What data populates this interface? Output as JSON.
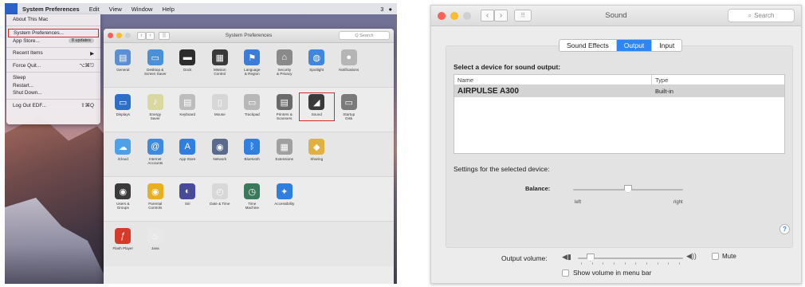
{
  "menubar": {
    "apple_glyph": "",
    "items": [
      "System Preferences",
      "Edit",
      "View",
      "Window",
      "Help"
    ],
    "status_text": "3"
  },
  "apple_menu": {
    "about": "About This Mac",
    "sysprefs": "System Preferences...",
    "appstore": "App Store...",
    "appstore_badge": "8 updates",
    "recent": "Recent Items",
    "recent_arrow": "▶",
    "force_quit": "Force Quit...",
    "force_quit_key": "⌥⌘⎋",
    "sleep": "Sleep",
    "restart": "Restart...",
    "shutdown": "Shut Down...",
    "logout": "Log Out EDF...",
    "logout_key": "⇧⌘Q"
  },
  "sysprefs": {
    "title": "System Preferences",
    "search": "Q Search",
    "rows": [
      [
        {
          "label": "General",
          "icon": "general-icon",
          "color": "#5a8fd6",
          "glyph": "▤"
        },
        {
          "label": "Desktop &\nScreen Saver",
          "icon": "desktop-icon",
          "color": "#4a90d9",
          "glyph": "▭"
        },
        {
          "label": "Dock",
          "icon": "dock-icon",
          "color": "#2c2c2c",
          "glyph": "▬"
        },
        {
          "label": "Mission\nControl",
          "icon": "mission-control-icon",
          "color": "#3a3a3a",
          "glyph": "▦"
        },
        {
          "label": "Language\n& Region",
          "icon": "language-icon",
          "color": "#3d7bd8",
          "glyph": "⚑"
        },
        {
          "label": "Security\n& Privacy",
          "icon": "security-icon",
          "color": "#8a8a8a",
          "glyph": "⌂"
        },
        {
          "label": "Spotlight",
          "icon": "spotlight-icon",
          "color": "#3f86e0",
          "glyph": "◍"
        },
        {
          "label": "Notifications",
          "icon": "notifications-icon",
          "color": "#b5b5b5",
          "glyph": "●"
        }
      ],
      [
        {
          "label": "Displays",
          "icon": "displays-icon",
          "color": "#2c6fc9",
          "glyph": "▭"
        },
        {
          "label": "Energy\nSaver",
          "icon": "energy-saver-icon",
          "color": "#d8d8a0",
          "glyph": "♪"
        },
        {
          "label": "Keyboard",
          "icon": "keyboard-icon",
          "color": "#bdbdbd",
          "glyph": "▤"
        },
        {
          "label": "Mouse",
          "icon": "mouse-icon",
          "color": "#d6d6d6",
          "glyph": "▯"
        },
        {
          "label": "Trackpad",
          "icon": "trackpad-icon",
          "color": "#b8b8b8",
          "glyph": "▭"
        },
        {
          "label": "Printers &\nScanners",
          "icon": "printer-icon",
          "color": "#6a6a6a",
          "glyph": "▤"
        },
        {
          "label": "Sound",
          "icon": "sound-icon",
          "color": "#3a3a3a",
          "glyph": "◢"
        },
        {
          "label": "Startup\nDisk",
          "icon": "startup-disk-icon",
          "color": "#7a7a7a",
          "glyph": "▭"
        }
      ],
      [
        {
          "label": "iCloud",
          "icon": "icloud-icon",
          "color": "#4ea0e8",
          "glyph": "☁"
        },
        {
          "label": "Internet\nAccounts",
          "icon": "internet-accounts-icon",
          "color": "#3d8be0",
          "glyph": "@"
        },
        {
          "label": "App Store",
          "icon": "app-store-icon",
          "color": "#2f7fe0",
          "glyph": "A"
        },
        {
          "label": "Network",
          "icon": "network-icon",
          "color": "#5a6a8a",
          "glyph": "◉"
        },
        {
          "label": "Bluetooth",
          "icon": "bluetooth-icon",
          "color": "#2f7fe0",
          "glyph": "ᛒ"
        },
        {
          "label": "Extensions",
          "icon": "extensions-icon",
          "color": "#a0a0a0",
          "glyph": "▦"
        },
        {
          "label": "Sharing",
          "icon": "sharing-icon",
          "color": "#e0b040",
          "glyph": "◆"
        }
      ],
      [
        {
          "label": "Users &\nGroups",
          "icon": "users-icon",
          "color": "#3a3a3a",
          "glyph": "◉"
        },
        {
          "label": "Parental\nControls",
          "icon": "parental-controls-icon",
          "color": "#e8b020",
          "glyph": "◉"
        },
        {
          "label": "Siri",
          "icon": "siri-icon",
          "color": "#4a4a9a",
          "glyph": "◐"
        },
        {
          "label": "Date & Time",
          "icon": "date-time-icon",
          "color": "#d8d8d8",
          "glyph": "◴"
        },
        {
          "label": "Time\nMachine",
          "icon": "time-machine-icon",
          "color": "#3a7a5a",
          "glyph": "◷"
        },
        {
          "label": "Accessibility",
          "icon": "accessibility-icon",
          "color": "#2f7fe0",
          "glyph": "✦"
        }
      ],
      [
        {
          "label": "Flash Player",
          "icon": "flash-player-icon",
          "color": "#d83a2a",
          "glyph": "ƒ"
        },
        {
          "label": "Java",
          "icon": "java-icon",
          "color": "#e8e8e8",
          "glyph": "♨"
        }
      ]
    ]
  },
  "sound": {
    "title": "Sound",
    "search": "Search",
    "tabs": [
      "Sound Effects",
      "Output",
      "Input"
    ],
    "active_tab": "Output",
    "select_heading": "Select a device for sound output:",
    "table": {
      "headers": [
        "Name",
        "Type"
      ],
      "rows": [
        {
          "name": "AIRPULSE A300",
          "type": "Built-in"
        }
      ]
    },
    "settings_heading": "Settings for the selected device:",
    "balance_label": "Balance:",
    "balance_left": "left",
    "balance_right": "right",
    "balance_value": 0.5,
    "help": "?",
    "output_volume_label": "Output volume:",
    "output_volume_value": 0.12,
    "mute_label": "Mute",
    "show_volume_label": "Show volume in menu bar",
    "accent_color": "#2f85f2"
  }
}
